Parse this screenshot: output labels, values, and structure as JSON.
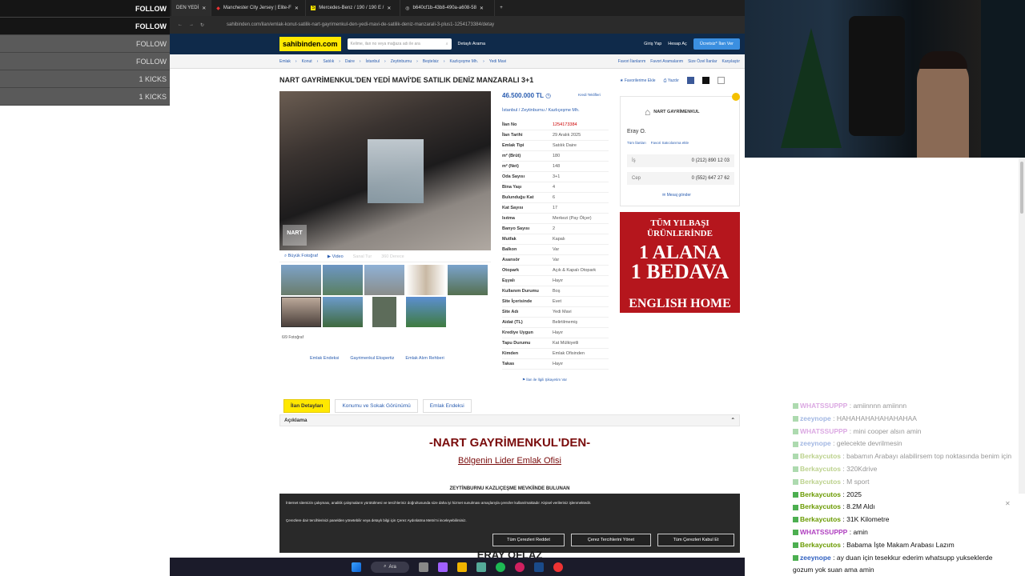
{
  "overlay": {
    "rows": [
      "FOLLOW",
      "FOLLOW",
      "FOLLOW",
      "FOLLOW",
      "1 KICKS",
      "1 KICKS"
    ]
  },
  "browser": {
    "tabs": [
      "DEN YEDİ",
      "Manchester City Jersey | Elite-F",
      "Mercedes-Benz / 190 / 190 E /",
      "b640cf1b-43b8-490a-a608-58"
    ],
    "url": "sahibinden.com/ilan/emlak-konut-satilik-nart-gayrimenkul-den-yedi-mavi-de-satilik-deniz-manzarali-3-plus1-1254173384/detay"
  },
  "header": {
    "logo": "sahibinden.com",
    "search_placeholder": "Kelime, ilan no veya mağaza adı ile ara",
    "detailed_search": "Detaylı Arama",
    "login": "Giriş Yap",
    "register": "Hesap Aç",
    "post_ad": "Ücretsiz* İlan Ver"
  },
  "breadcrumb": [
    "Emlak",
    "Konut",
    "Satılık",
    "Daire",
    "İstanbul",
    "Zeytinburnu",
    "Beştelsiz",
    "Kazlıçeşme Mh.",
    "Yedi Mavi"
  ],
  "breadcrumb_right": [
    "Favori İlanlarım",
    "Favori Aramalarım",
    "Size Özel İlanlar",
    "Karşılaştır"
  ],
  "listing": {
    "title": "NART GAYRİMENKUL'DEN YEDİ MAVİ'DE SATILIK DENİZ MANZARALI 3+1",
    "actions": [
      "Favorilerime Ekle",
      "Yazdır"
    ],
    "price": "46.500.000 TL",
    "credit_link": "Kredi Teklifleri",
    "location": "İstanbul / Zeytinburnu / Kazlıçeşme Mh.",
    "photo_tabs": [
      "Büyük Fotoğraf",
      "Video",
      "Sanal Tur",
      "360 Derece"
    ],
    "photo_count": "6/9 Fotoğraf",
    "photo_watermark": "NART",
    "photo_links": [
      "Emlak Endeksi",
      "Gayrimenkul Ekspertiz",
      "Emlak Alım Rehberi"
    ],
    "complaint": "İlan ile İlgili Şikayetim Var",
    "details": [
      {
        "label": "İlan No",
        "value": "1254173384"
      },
      {
        "label": "İlan Tarihi",
        "value": "29 Aralık 2025"
      },
      {
        "label": "Emlak Tipi",
        "value": "Satılık Daire"
      },
      {
        "label": "m² (Brüt)",
        "value": "180"
      },
      {
        "label": "m² (Net)",
        "value": "148"
      },
      {
        "label": "Oda Sayısı",
        "value": "3+1"
      },
      {
        "label": "Bina Yaşı",
        "value": "4"
      },
      {
        "label": "Bulunduğu Kat",
        "value": "6"
      },
      {
        "label": "Kat Sayısı",
        "value": "17"
      },
      {
        "label": "Isıtma",
        "value": "Merkezi (Pay Ölçer)"
      },
      {
        "label": "Banyo Sayısı",
        "value": "2"
      },
      {
        "label": "Mutfak",
        "value": "Kapalı"
      },
      {
        "label": "Balkon",
        "value": "Var"
      },
      {
        "label": "Asansör",
        "value": "Var"
      },
      {
        "label": "Otopark",
        "value": "Açık & Kapalı Otopark"
      },
      {
        "label": "Eşyalı",
        "value": "Hayır"
      },
      {
        "label": "Kullanım Durumu",
        "value": "Boş"
      },
      {
        "label": "Site İçerisinde",
        "value": "Evet"
      },
      {
        "label": "Site Adı",
        "value": "Yedi Mavi"
      },
      {
        "label": "Aidat (TL)",
        "value": "Belirtilmemiş"
      },
      {
        "label": "Krediye Uygun",
        "value": "Hayır"
      },
      {
        "label": "Tapu Durumu",
        "value": "Kat Mülkiyetli"
      },
      {
        "label": "Kimden",
        "value": "Emlak Ofisinden"
      },
      {
        "label": "Takas",
        "value": "Hayır"
      }
    ]
  },
  "seller": {
    "company": "NART GAYRİMENKUL",
    "name": "Eray O.",
    "links": [
      "Tüm İlanları",
      "Favori Satıcılarıma ekle"
    ],
    "phones": [
      {
        "label": "İş",
        "number": "0 (212) 890 12 03"
      },
      {
        "label": "Cep",
        "number": "0 (552) 647 27 62"
      }
    ],
    "message": "Mesaj gönder"
  },
  "ad": {
    "line1": "TÜM YILBAŞI",
    "line2": "ÜRÜNLERİNDE",
    "line3": "1 ALANA",
    "line4": "1 BEDAVA",
    "line5": "ENGLISH HOME"
  },
  "detail_tabs": [
    "İlan Detayları",
    "Konumu ve Sokak Görünümü",
    "Emlak Endeksi"
  ],
  "description": {
    "header": "Açıklama",
    "title": "-NART GAYRİMENKUL'DEN-",
    "subtitle": "Bölgenin Lider Emlak Ofisi",
    "text": "ZEYTİNBURNU KAZLIÇEŞME MEVKİİNDE BULUNAN",
    "signature": "ERAY OFLAZ"
  },
  "cookie": {
    "text1": "İnternet sitemizin çalışması, analitik çalışmaların yürütülmesi ve tercihleriniz doğrultusunda size daha iyi hizmet sunulması amaçlarıyla çerezler kullanılmaktadır. Kişisel verileriniz işlenmektedir.",
    "text2": "Çerezlere dair tercihlerinizi panelden yönetebilir veya detaylı bilgi için Çerez Aydınlatma Metni'ni inceleyebilirsiniz.",
    "buttons": [
      "Tüm Çerezleri Reddet",
      "Çerez Tercihlerini Yönet",
      "Tüm Çerezleri Kabul Et"
    ]
  },
  "chat": [
    {
      "user": "WHATSSUPPP",
      "msg": "amiinnnn amiinnn",
      "color": "#b040c0",
      "faded": true
    },
    {
      "user": "zeeynope",
      "msg": "HAHAHAHAHAHAHAHAA",
      "color": "#3060c0",
      "faded": true
    },
    {
      "user": "WHATSSUPPP",
      "msg": "mini cooper alsın amin",
      "color": "#b040c0",
      "faded": true
    },
    {
      "user": "zeeynope",
      "msg": "gelecekte devrilmesin",
      "color": "#3060c0",
      "faded": true
    },
    {
      "user": "Berkaycutos",
      "msg": "babamın Arabayı alabilirsem top noktasında benim için",
      "color": "#6a9a00",
      "faded": true
    },
    {
      "user": "Berkaycutos",
      "msg": "320Kdrive",
      "color": "#6a9a00",
      "faded": true
    },
    {
      "user": "Berkaycutos",
      "msg": "M sport",
      "color": "#6a9a00",
      "faded": true
    },
    {
      "user": "Berkaycutos",
      "msg": "2025",
      "color": "#6a9a00",
      "faded": false
    },
    {
      "user": "Berkaycutos",
      "msg": "8.2M Aldı",
      "color": "#6a9a00",
      "faded": false
    },
    {
      "user": "Berkaycutos",
      "msg": "31K Kilometre",
      "color": "#6a9a00",
      "faded": false
    },
    {
      "user": "WHATSSUPPP",
      "msg": "amin",
      "color": "#b040c0",
      "faded": false
    },
    {
      "user": "Berkaycutos",
      "msg": "Babama İşte Makam Arabası Lazım",
      "color": "#6a9a00",
      "faded": false
    },
    {
      "user": "zeeynope",
      "msg": "ay duan için tesekkur ederim whatsupp yukseklerde",
      "color": "#3060c0",
      "faded": false
    },
    {
      "user": "",
      "msg": "gozum yok suan ama amin",
      "color": "#3060c0",
      "faded": false
    }
  ],
  "taskbar": {
    "search": "Ara"
  }
}
